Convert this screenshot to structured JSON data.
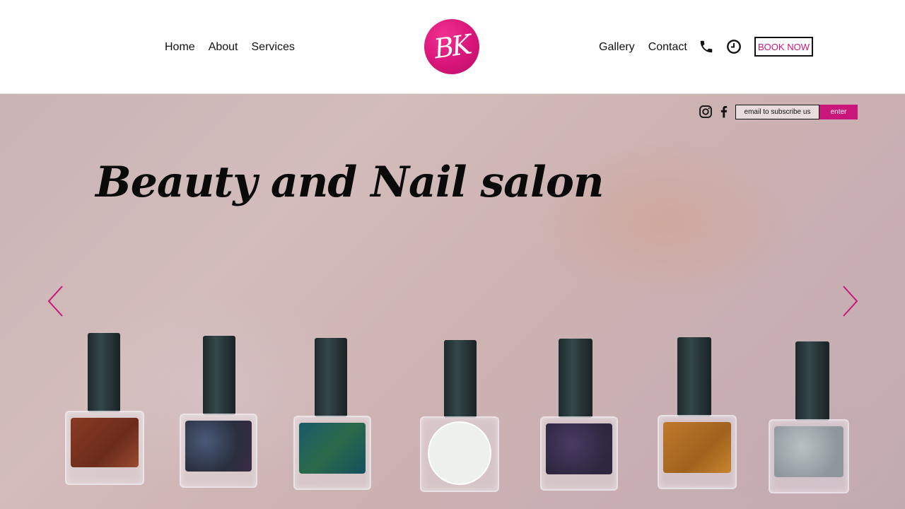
{
  "nav": {
    "left": [
      "Home",
      "About",
      "Services"
    ],
    "right": [
      "Gallery",
      "Contact"
    ]
  },
  "logo": {
    "text": "BK",
    "color": "#d8157a"
  },
  "header_actions": {
    "phone_icon": "phone-icon",
    "clock_icon": "clock-icon",
    "book_now": "BOOK NOW"
  },
  "hero": {
    "title": "Beauty and Nail salon",
    "social": [
      "instagram-icon",
      "facebook-icon"
    ],
    "subscribe_placeholder": "email to subscribe us",
    "subscribe_button": "enter",
    "prev_icon": "chevron-left-icon",
    "next_icon": "chevron-right-icon",
    "accent": "#c8167a"
  }
}
